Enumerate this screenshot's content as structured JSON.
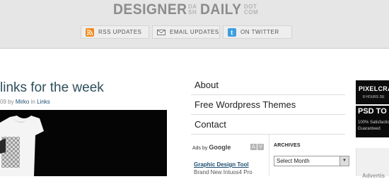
{
  "header": {
    "logo": {
      "word1": "DESIGNER",
      "small1": "DA SH",
      "word2": "DAILY",
      "small2": "DOT COM"
    },
    "social": {
      "rss": "RSS UPDATES",
      "email": "EMAIL UPDATES",
      "twitter": "ON TWITTER"
    }
  },
  "post": {
    "title": "links for the week",
    "meta_date_fragment": "09",
    "meta_by": "by",
    "author": "Mirko",
    "meta_in": "in",
    "category": "Links"
  },
  "nav": {
    "items": [
      {
        "label": "About"
      },
      {
        "label": "Free Wordpress Themes"
      },
      {
        "label": "Contact"
      }
    ]
  },
  "ads": {
    "ads_by": "Ads by",
    "google": "Google",
    "prev": "Δ",
    "next": "V",
    "ad_title": "Graphic Design Tool",
    "ad_desc": "Brand New Intuos4 Pro"
  },
  "archives": {
    "label": "ARCHIVES",
    "selected": "Select Month"
  },
  "banners": {
    "pixelcrafter": {
      "line1": "PIXELCRA",
      "line2": "8 HOURS DE"
    },
    "psd": {
      "line1": "PSD TO X",
      "line2": "100% Satisfactio",
      "line3": "Guaranteed"
    },
    "side_text": "Advertis"
  },
  "colors": {
    "header_bg": "#e6e6e6",
    "logo_gray": "#8c8c8c",
    "title_teal": "#2f4f5c",
    "link_blue": "#1e4e70",
    "rss_orange": "#f18a1e",
    "twitter_blue": "#3d9ee0"
  }
}
